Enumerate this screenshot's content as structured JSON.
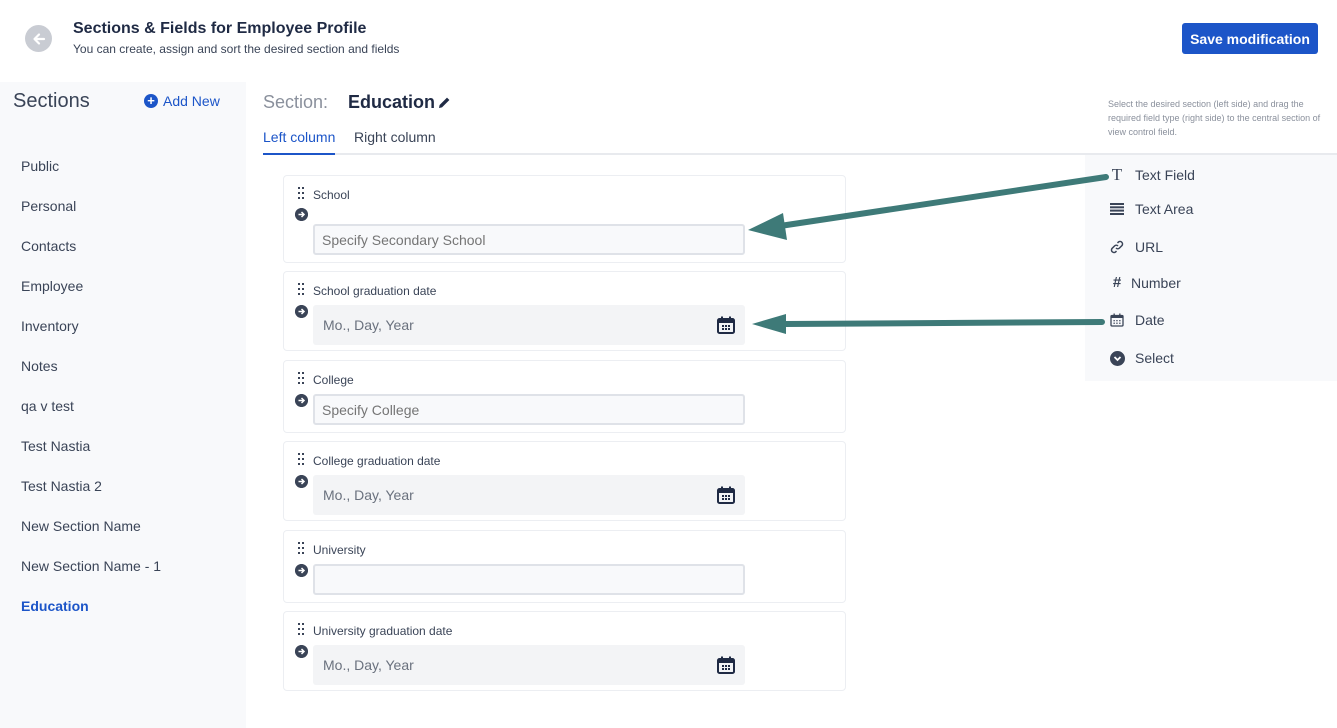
{
  "header": {
    "title": "Sections & Fields for Employee Profile",
    "subtitle": "You can create, assign and sort the desired section and fields",
    "save_label": "Save modification"
  },
  "sidebar": {
    "title": "Sections",
    "add_new_label": "Add New",
    "items": [
      {
        "label": "Public",
        "active": false
      },
      {
        "label": "Personal",
        "active": false
      },
      {
        "label": "Contacts",
        "active": false
      },
      {
        "label": "Employee",
        "active": false
      },
      {
        "label": "Inventory",
        "active": false
      },
      {
        "label": "Notes",
        "active": false
      },
      {
        "label": "qa v test",
        "active": false
      },
      {
        "label": "Test Nastia",
        "active": false
      },
      {
        "label": "Test Nastia 2",
        "active": false
      },
      {
        "label": "New Section Name",
        "active": false
      },
      {
        "label": "New Section Name - 1",
        "active": false
      },
      {
        "label": "Education",
        "active": true
      }
    ]
  },
  "main": {
    "section_label": "Section:",
    "section_name": "Education",
    "tabs": [
      {
        "label": "Left column",
        "active": true
      },
      {
        "label": "Right column",
        "active": false
      }
    ],
    "fields": [
      {
        "label": "School",
        "type": "text",
        "placeholder": "Specify Secondary School"
      },
      {
        "label": "School graduation date",
        "type": "date",
        "placeholder": "Mo., Day, Year"
      },
      {
        "label": "College",
        "type": "text",
        "placeholder": "Specify College"
      },
      {
        "label": "College graduation date",
        "type": "date",
        "placeholder": "Mo., Day, Year"
      },
      {
        "label": "University",
        "type": "text",
        "placeholder": ""
      },
      {
        "label": "University graduation date",
        "type": "date",
        "placeholder": "Mo., Day, Year"
      }
    ]
  },
  "palette": {
    "hint": "Select the desired section (left side) and drag the required field type (right side) to the central section of view control field.",
    "items": [
      {
        "label": "Text Field",
        "icon": "text-field-icon"
      },
      {
        "label": "Text Area",
        "icon": "text-area-icon"
      },
      {
        "label": "URL",
        "icon": "link-icon"
      },
      {
        "label": "Number",
        "icon": "hash-icon"
      },
      {
        "label": "Date",
        "icon": "calendar-icon"
      },
      {
        "label": "Select",
        "icon": "select-chevron-icon"
      }
    ]
  },
  "colors": {
    "accent": "#1c55c8",
    "annotation_arrow": "#3e7a78",
    "text_dark": "#1f2a44"
  }
}
